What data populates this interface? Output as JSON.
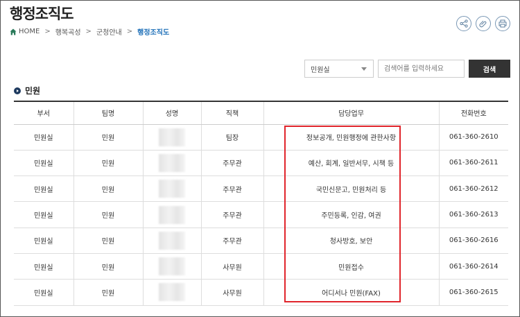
{
  "page_title": "행정조직도",
  "breadcrumb": {
    "home": "HOME",
    "items": [
      "행복곡성",
      "군청안내"
    ],
    "current": "행정조직도"
  },
  "toolbar": {
    "share_icon": "share-icon",
    "link_icon": "paperclip-icon",
    "print_icon": "print-icon"
  },
  "search": {
    "select_value": "민원실",
    "placeholder": "검색어를 입력하세요",
    "button_label": "검색"
  },
  "section": {
    "title": "민원"
  },
  "table": {
    "headers": [
      "부서",
      "팀명",
      "성명",
      "직책",
      "담당업무",
      "전화번호"
    ],
    "rows": [
      {
        "dept": "민원실",
        "team": "민원",
        "position": "팀장",
        "duty": "정보공개, 민원행정에 관한사항",
        "phone": "061-360-2610"
      },
      {
        "dept": "민원실",
        "team": "민원",
        "position": "주무관",
        "duty": "예산, 회계, 일반서무, 시책 등",
        "phone": "061-360-2611"
      },
      {
        "dept": "민원실",
        "team": "민원",
        "position": "주무관",
        "duty": "국민신문고, 민원처리 등",
        "phone": "061-360-2612"
      },
      {
        "dept": "민원실",
        "team": "민원",
        "position": "주무관",
        "duty": "주민등록, 인감, 여권",
        "phone": "061-360-2613"
      },
      {
        "dept": "민원실",
        "team": "민원",
        "position": "주무관",
        "duty": "청사방호, 보안",
        "phone": "061-360-2616"
      },
      {
        "dept": "민원실",
        "team": "민원",
        "position": "사무원",
        "duty": "민원접수",
        "phone": "061-360-2614"
      },
      {
        "dept": "민원실",
        "team": "민원",
        "position": "사무원",
        "duty": "어디서나 민원(FAX)",
        "phone": "061-360-2615"
      }
    ]
  },
  "colors": {
    "accent": "#1d6fb8",
    "highlight": "#e0242b",
    "search_button": "#333333"
  }
}
